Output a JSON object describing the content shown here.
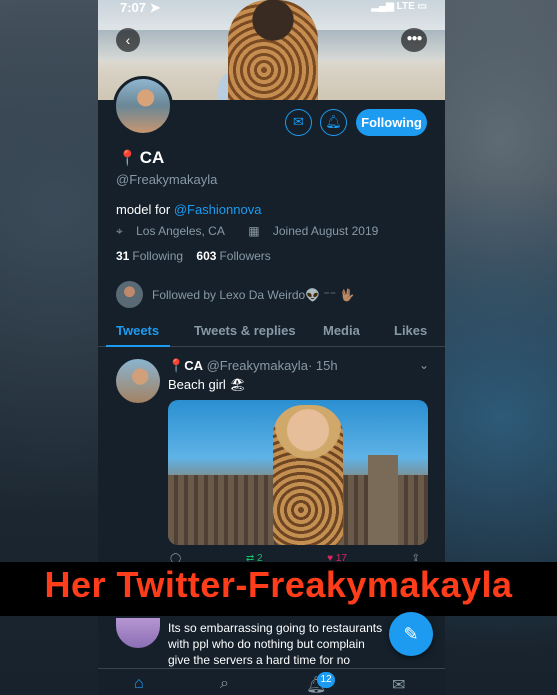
{
  "status_bar": {
    "time": "7:07",
    "carrier": "LTE"
  },
  "profile": {
    "name": "CA",
    "handle": "@Freakymakayla",
    "bio_prefix": "model for ",
    "bio_link": "@Fashionnova",
    "location": "Los Angeles, CA",
    "joined": "Joined August 2019",
    "following_count": "31",
    "following_label": "Following",
    "followers_count": "603",
    "followers_label": "Followers",
    "followed_by": "Followed by Lexo Da Weirdo👽 ⁻⁻ 🖖🏽",
    "follow_button": "Following"
  },
  "tabs": [
    {
      "label": "Tweets",
      "active": true
    },
    {
      "label": "Tweets & replies",
      "active": false
    },
    {
      "label": "Media",
      "active": false
    },
    {
      "label": "Likes",
      "active": false
    }
  ],
  "tweets": [
    {
      "name": "CA",
      "handle": "@Freakymakayla",
      "time": "· 15h",
      "text": "Beach girl 🏖",
      "reply_count": "",
      "retweet_count": "2",
      "like_count": "17"
    },
    {
      "text_lines": [
        "Its so embarrassing going to restaurants",
        "with ppl who do nothing but complain",
        "give the servers a hard time for no"
      ]
    }
  ],
  "caption": "Her Twitter-Freakymakayla",
  "bottom_nav": {
    "notification_badge": "12"
  },
  "icons": {
    "back": "chevron-left-icon",
    "more": "more-icon",
    "mail": "mail-icon",
    "bell": "bell-add-icon",
    "location": "location-icon",
    "calendar": "calendar-icon",
    "compose": "compose-icon",
    "home": "home-icon",
    "search": "search-icon",
    "notifications": "bell-icon",
    "messages": "mail-icon"
  },
  "colors": {
    "accent": "#1d9bf0",
    "background": "#15202b",
    "caption_text": "#ff3d1a"
  }
}
